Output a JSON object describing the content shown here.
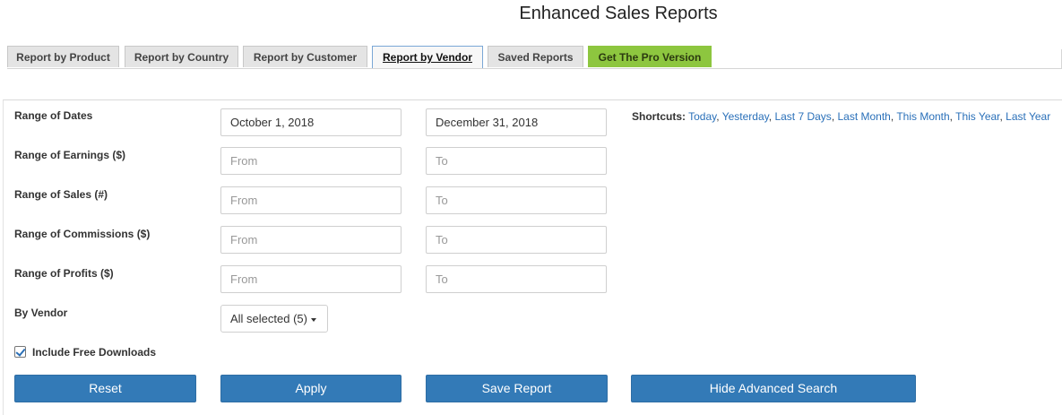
{
  "page": {
    "title": "Enhanced Sales Reports"
  },
  "tabs": [
    {
      "label": "Report by Product"
    },
    {
      "label": "Report by Country"
    },
    {
      "label": "Report by Customer"
    },
    {
      "label": "Report by Vendor",
      "active": true
    },
    {
      "label": "Saved Reports"
    },
    {
      "label": "Get The Pro Version"
    }
  ],
  "colors": {
    "accent": "#337ab7",
    "pro_tab": "#8dc63f",
    "link": "#2a70b9"
  },
  "form": {
    "dates": {
      "label": "Range of Dates",
      "from_value": "October 1, 2018",
      "to_value": "December 31, 2018"
    },
    "earnings": {
      "label": "Range of Earnings ($)",
      "from_placeholder": "From",
      "to_placeholder": "To"
    },
    "sales": {
      "label": "Range of Sales (#)",
      "from_placeholder": "From",
      "to_placeholder": "To"
    },
    "commissions": {
      "label": "Range of Commissions ($)",
      "from_placeholder": "From",
      "to_placeholder": "To"
    },
    "profits": {
      "label": "Range of Profits ($)",
      "from_placeholder": "From",
      "to_placeholder": "To"
    },
    "vendor": {
      "label": "By Vendor",
      "selected": "All selected (5)"
    },
    "free_downloads": {
      "label": "Include Free Downloads",
      "checked": true
    }
  },
  "shortcuts": {
    "label": "Shortcuts:",
    "items": [
      "Today",
      "Yesterday",
      "Last 7 Days",
      "Last Month",
      "This Month",
      "This Year",
      "Last Year"
    ]
  },
  "buttons": {
    "reset": "Reset",
    "apply": "Apply",
    "save": "Save Report",
    "hide_advanced": "Hide Advanced Search"
  }
}
